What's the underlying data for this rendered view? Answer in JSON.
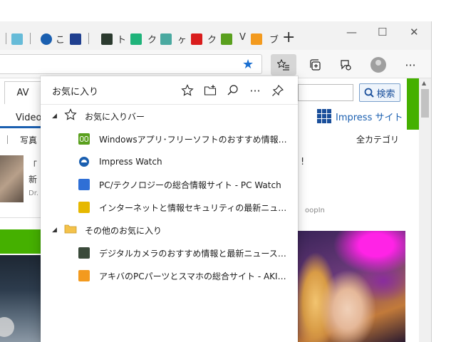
{
  "browser": {
    "tab_chars": [
      "こ",
      "ト",
      "ク",
      "ヶ",
      "ク",
      "V",
      "ブ"
    ],
    "new_tab_symbol": "+",
    "window_controls": {
      "minimize": "—",
      "maximize": "☐",
      "close": "✕"
    },
    "toolbar_more": "···"
  },
  "page_behind": {
    "nav_av": "AV",
    "nav_video": "Video",
    "photo": "写真",
    "search_button": "検索",
    "impress_site": "Impress サイト",
    "all_categories": "全カテゴリ",
    "left_card_lines": [
      "「",
      "新"
    ],
    "left_card_small": "Dr.",
    "right_card_line": "!",
    "right_card_small": "oopIn"
  },
  "favorites": {
    "title": "お気に入り",
    "bar_folder": "お気に入りバー",
    "bar_items": [
      {
        "label": "Windowsアプリ･フリーソフトのおすすめ情報 - 窓の杜",
        "icon": "madonomori-icon",
        "color": "#5aa01e"
      },
      {
        "label": "Impress Watch",
        "icon": "impress-watch-icon",
        "color": "#1a5fb0"
      },
      {
        "label": "PC/テクノロジーの総合情報サイト - PC Watch",
        "icon": "pc-watch-icon",
        "color": "#2f6fd6"
      },
      {
        "label": "インターネットと情報セキュリティの最新ニュース - INTER...",
        "icon": "internet-watch-icon",
        "color": "#e6b800"
      }
    ],
    "other_folder": "その他のお気に入り",
    "other_items": [
      {
        "label": "デジタルカメラのおすすめ情報と最新ニュース - デジカメ ...",
        "icon": "dc-watch-icon",
        "color": "#3a4a3a"
      },
      {
        "label": "アキバのPCパーツとスマホの総合サイト - AKIBA PC Hot...",
        "icon": "akiba-icon",
        "color": "#f39a1e"
      }
    ]
  },
  "colors": {
    "accent": "#1a6fd1",
    "site_green": "#45b000",
    "folder_yellow": "#f4c24a"
  }
}
